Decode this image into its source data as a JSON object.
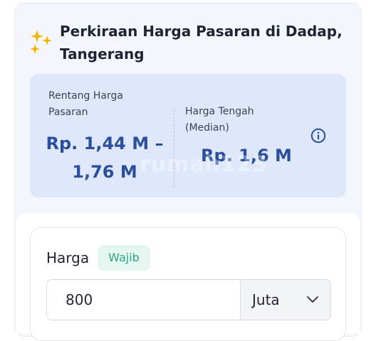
{
  "header": {
    "title": "Perkiraan Harga Pasaran di Dadap, Tangerang",
    "icon": "sparkles-icon"
  },
  "price_summary": {
    "range_label": "Rentang Harga Pasaran",
    "range_value": "Rp. 1,44 M – 1,76 M",
    "median_label": "Harga Tengah (Median)",
    "median_value": "Rp. 1,6 M",
    "info_icon": "info-icon",
    "watermark": "rumah123"
  },
  "form": {
    "price_label": "Harga",
    "required_badge": "Wajib",
    "price_value": "800",
    "unit_selected": "Juta",
    "unit_icon": "chevron-down-icon"
  },
  "colors": {
    "accent_blue": "#2c4f9c",
    "card_bg": "#dfe8fb",
    "badge_green": "#2aa883",
    "sparkle_gold": "#f4b400"
  }
}
